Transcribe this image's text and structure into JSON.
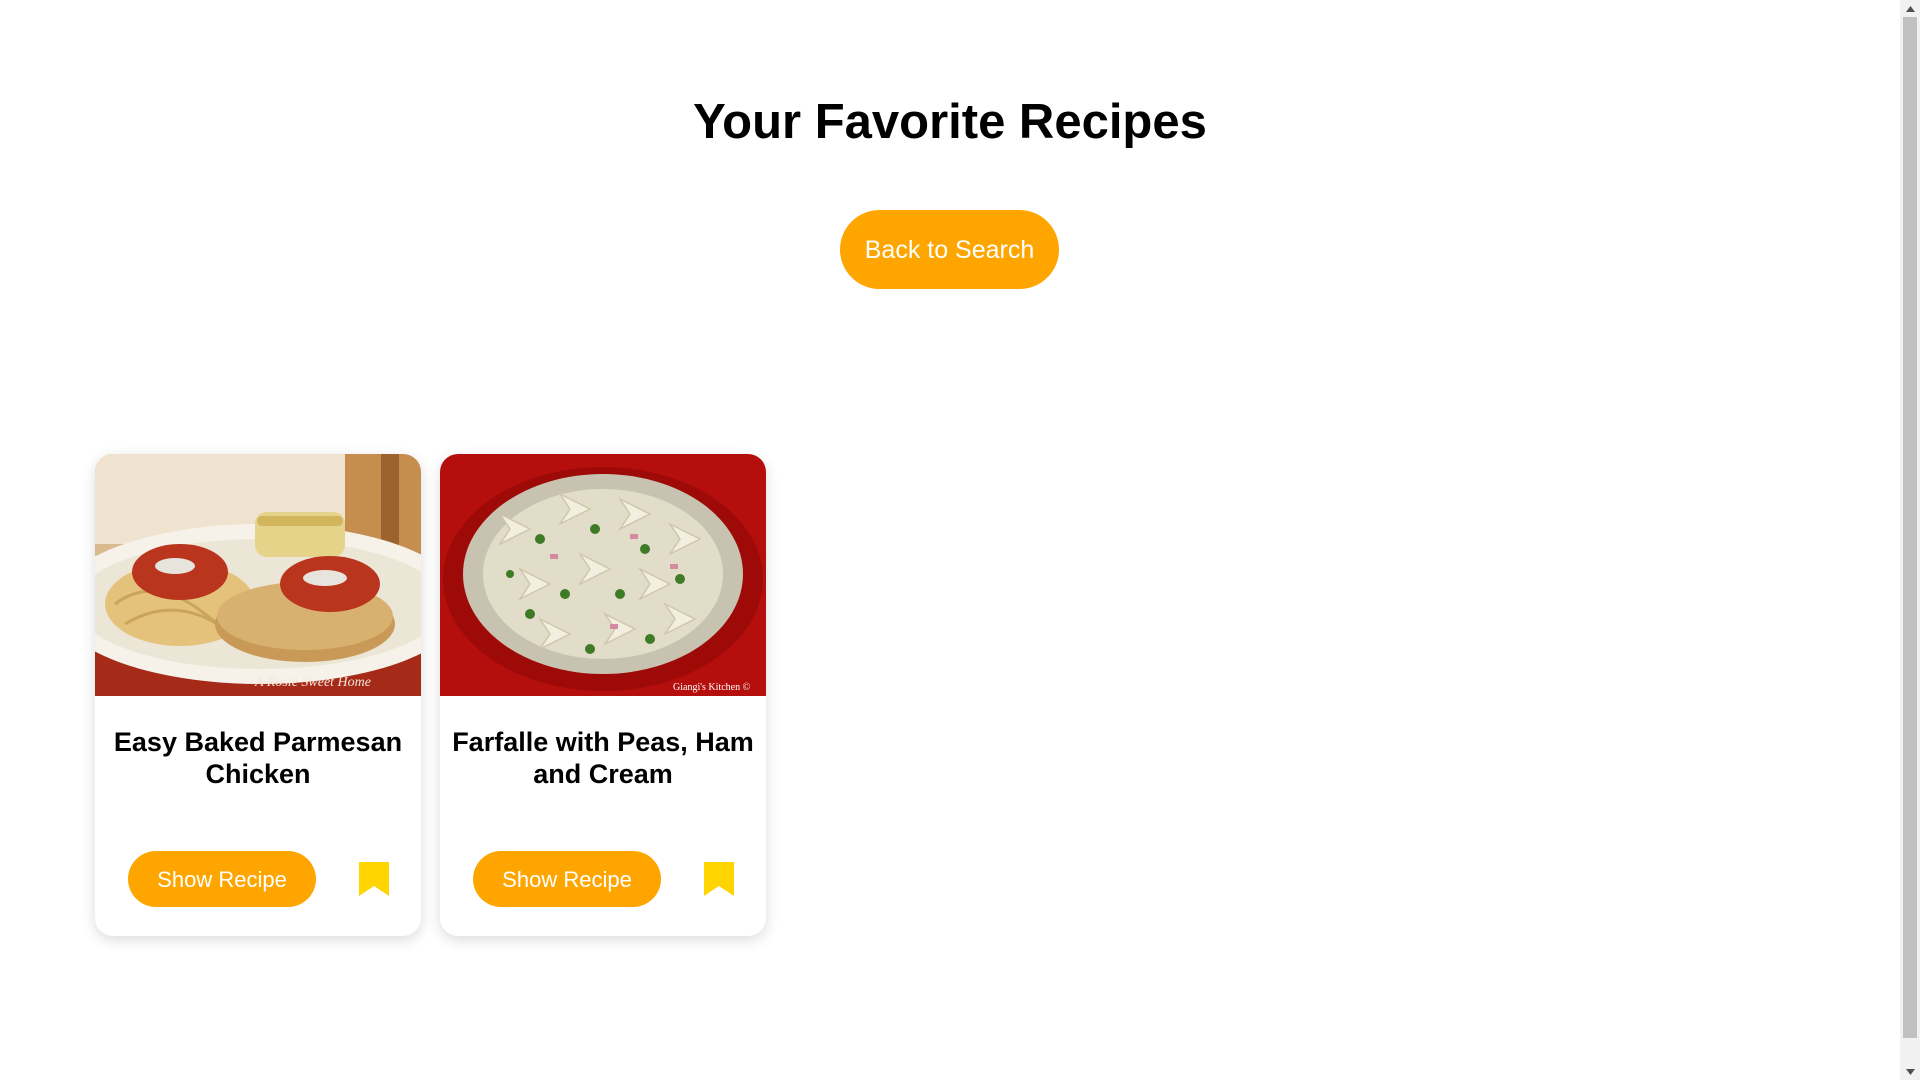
{
  "header": {
    "title": "Your Favorite Recipes"
  },
  "actions": {
    "back_label": "Back to Search"
  },
  "colors": {
    "accent": "#ffa500",
    "bookmark": "#ffd400",
    "button_text": "#ffffff"
  },
  "recipes": [
    {
      "title": "Easy Baked Parmesan Chicken",
      "button_label": "Show Recipe",
      "image_watermark": "A Rosie Sweet Home",
      "bookmark_icon": "bookmark-icon"
    },
    {
      "title": "Farfalle with Peas, Ham and Cream",
      "button_label": "Show Recipe",
      "image_watermark": "Giangi's Kitchen ©",
      "bookmark_icon": "bookmark-icon"
    }
  ]
}
